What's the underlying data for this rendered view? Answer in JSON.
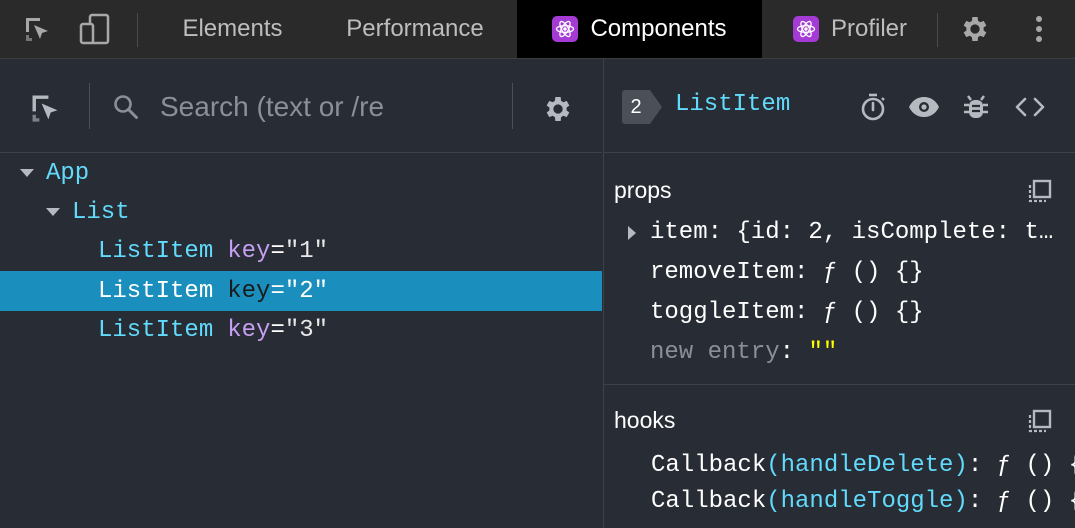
{
  "topbar": {
    "tabs": [
      {
        "label": "Elements"
      },
      {
        "label": "Performance"
      },
      {
        "label": "Components"
      },
      {
        "label": "Profiler"
      }
    ]
  },
  "tree": {
    "search_placeholder": "Search (text or /re",
    "nodes": [
      {
        "name": "App",
        "depth": 0
      },
      {
        "name": "List",
        "depth": 1
      },
      {
        "name": "ListItem",
        "key_label": "key",
        "key_value": "\"1\""
      },
      {
        "name": "ListItem",
        "key_label": "key",
        "key_value": "\"2\"",
        "selected": true
      },
      {
        "name": "ListItem",
        "key_label": "key",
        "key_value": "\"3\""
      }
    ]
  },
  "inspector": {
    "badge": "2",
    "title": "ListItem",
    "props_title": "props",
    "props": [
      {
        "text": "item: {id: 2, isComplete: t…"
      },
      {
        "text": "removeItem: ƒ () {}"
      },
      {
        "text": "toggleItem: ƒ () {}"
      }
    ],
    "new_entry_label": "new entry",
    "new_entry_colon": ":",
    "new_entry_value": "\"\"",
    "hooks_title": "hooks",
    "hooks": [
      {
        "name": "Callback",
        "arg": "(handleDelete)",
        "value": ": ƒ () {}"
      },
      {
        "name": "Callback",
        "arg": "(handleToggle)",
        "value": ": ƒ () {}"
      }
    ]
  },
  "colors": {
    "accent": "#61dafb",
    "selection": "#1a8fbd",
    "react_badge": "#a43bd4",
    "key_attr": "#c69ff2"
  },
  "icons": [
    "select-element-icon",
    "device-toolbar-icon",
    "react-logo-icon",
    "settings-gear-icon",
    "more-vert-icon",
    "search-icon",
    "stopwatch-icon",
    "eye-icon",
    "bug-icon",
    "code-icon",
    "copy-icon"
  ]
}
